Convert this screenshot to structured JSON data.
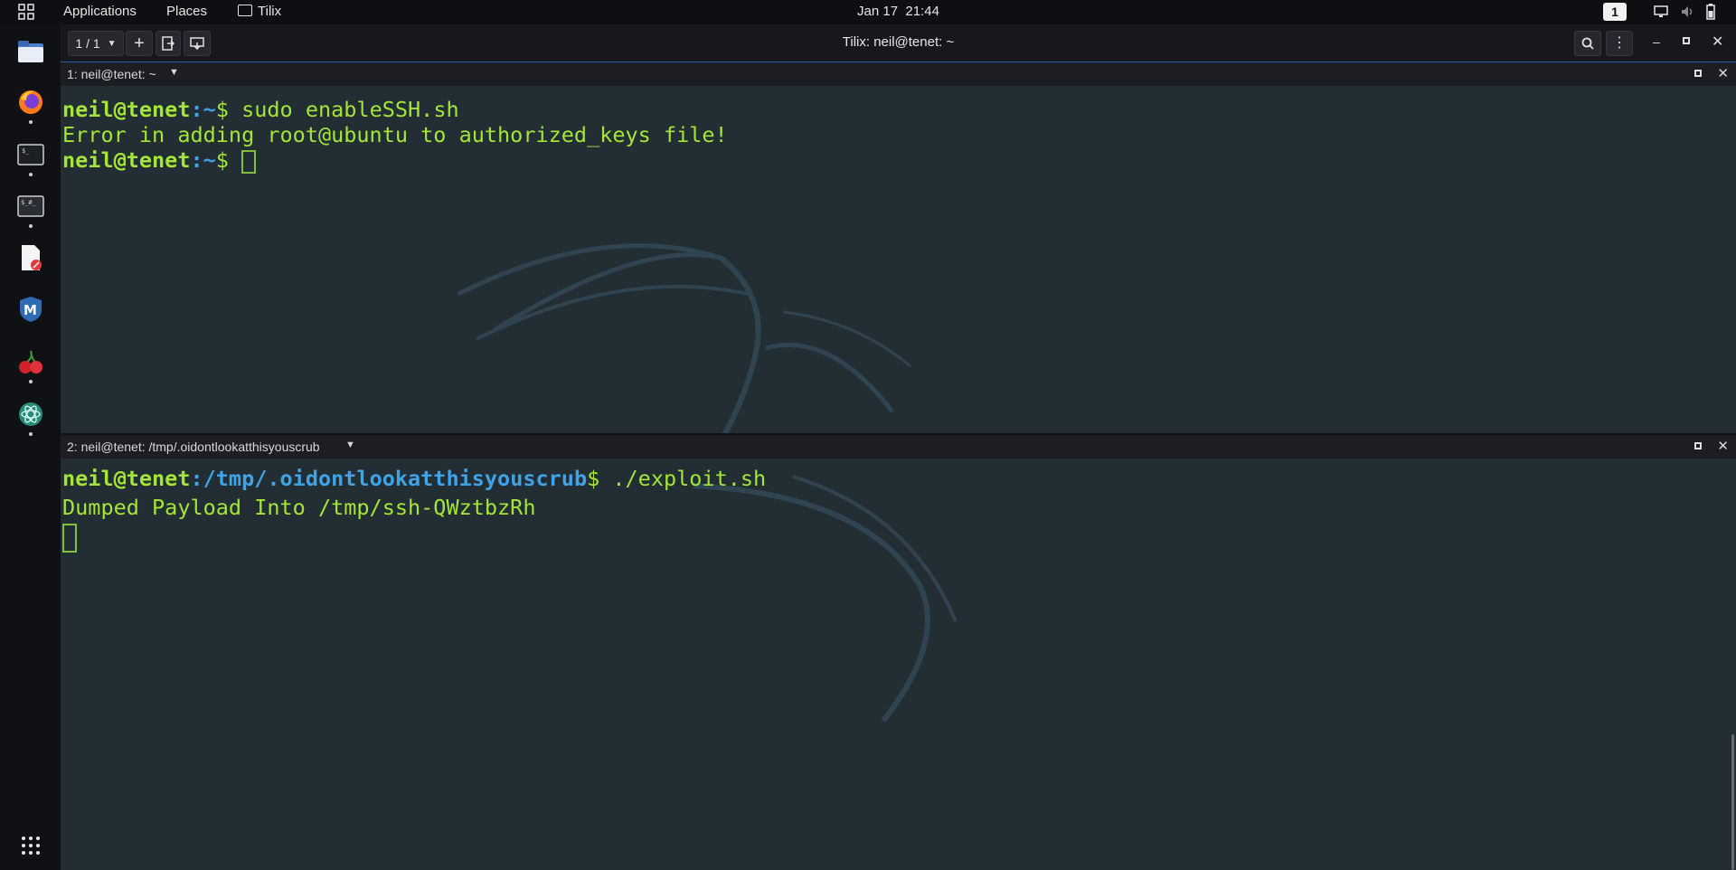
{
  "topbar": {
    "applications": "Applications",
    "places": "Places",
    "app_name": "Tilix",
    "clock": "Jan 17  21:44",
    "workspace": "1"
  },
  "dock": {
    "items": [
      {
        "name": "files"
      },
      {
        "name": "firefox"
      },
      {
        "name": "terminal"
      },
      {
        "name": "root-terminal"
      },
      {
        "name": "text-editor"
      },
      {
        "name": "metasploit"
      },
      {
        "name": "cherrytree"
      },
      {
        "name": "burp"
      }
    ]
  },
  "window": {
    "session_selector": "1 / 1",
    "title": "Tilix: neil@tenet: ~"
  },
  "pane1": {
    "header": "1: neil@tenet: ~",
    "line1_user": "neil@tenet",
    "line1_colon": ":",
    "line1_path": "~",
    "line1_cmd": "$ sudo enableSSH.sh",
    "line2": "Error in adding root@ubuntu to authorized_keys file!",
    "line3_user": "neil@tenet",
    "line3_colon": ":",
    "line3_path": "~",
    "line3_cmd": "$ "
  },
  "pane2": {
    "header": "2: neil@tenet: /tmp/.oidontlookatthisyouscrub",
    "line1_user": "neil@tenet",
    "line1_colon": ":",
    "line1_path": "/tmp/.oidontlookatthisyouscrub",
    "line1_cmd": "$ ./exploit.sh",
    "line2": "Dumped Payload Into /tmp/ssh-QWztbzRh"
  },
  "colors": {
    "prompt_green": "#a3e635",
    "path_blue": "#3fa3e8",
    "accent_blue": "#2d5da8",
    "terminal_bg": "#232e34"
  }
}
